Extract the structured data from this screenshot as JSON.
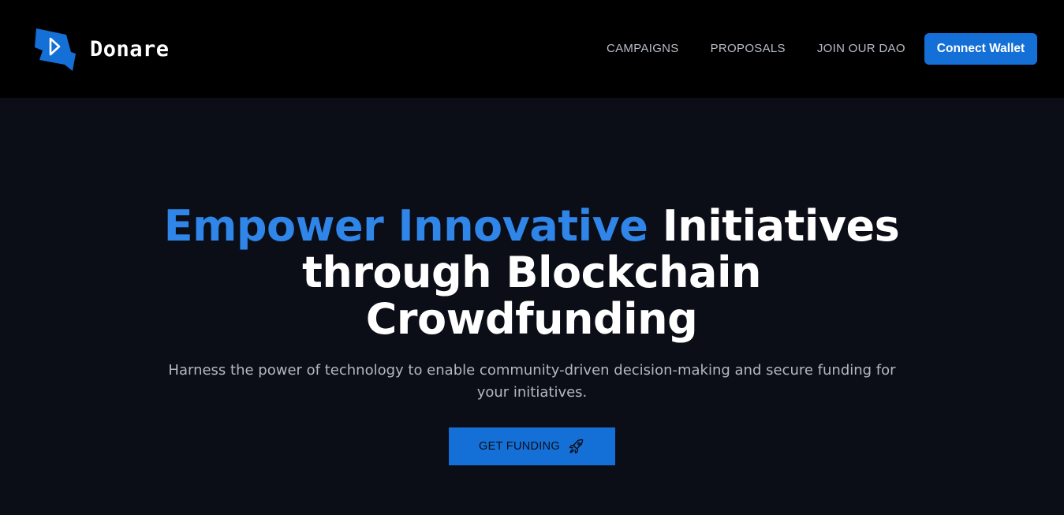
{
  "brand": {
    "name": "Donare",
    "logo_icon": "play-flag-logo-icon",
    "color": "#1470d7"
  },
  "nav": {
    "links": [
      {
        "label": "CAMPAIGNS"
      },
      {
        "label": "PROPOSALS"
      },
      {
        "label": "JOIN OUR DAO"
      }
    ],
    "connect_label": "Connect Wallet"
  },
  "hero": {
    "headline_accent": "Empower Innovative",
    "headline_rest_1": " Initiatives",
    "headline_rest_2": "through Blockchain",
    "headline_rest_3": "Crowdfunding",
    "subtitle": "Harness the power of technology to enable community-driven decision-making and secure funding for your initiatives.",
    "cta_label": "GET FUNDING",
    "cta_icon": "rocket-icon"
  },
  "colors": {
    "accent": "#2f86e8",
    "button": "#1470d7",
    "nav_background": "#000000",
    "hero_background": "#0b0d17"
  }
}
